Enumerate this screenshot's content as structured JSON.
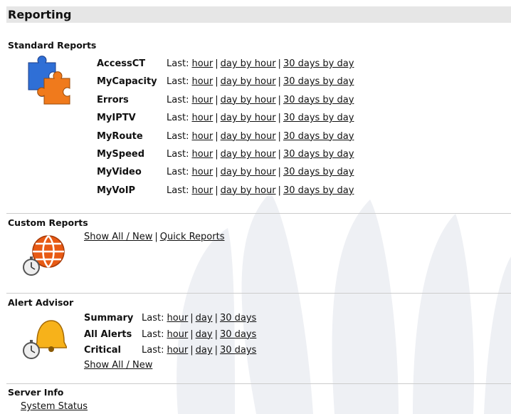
{
  "page": {
    "title": "Reporting"
  },
  "standard_reports": {
    "title": "Standard Reports",
    "last_label": "Last:",
    "links": {
      "hour": "hour",
      "day_by_hour": "day by hour",
      "days30": "30 days by day"
    },
    "items": [
      {
        "name": "AccessCT"
      },
      {
        "name": "MyCapacity"
      },
      {
        "name": "Errors"
      },
      {
        "name": "MyIPTV"
      },
      {
        "name": "MyRoute"
      },
      {
        "name": "MySpeed"
      },
      {
        "name": "MyVideo"
      },
      {
        "name": "MyVoIP"
      }
    ]
  },
  "custom_reports": {
    "title": "Custom Reports",
    "show_all": "Show All / New",
    "quick": "Quick Reports",
    "separator": "|"
  },
  "alert_advisor": {
    "title": "Alert Advisor",
    "last_label": "Last:",
    "links": {
      "hour": "hour",
      "day": "day",
      "days30": "30 days"
    },
    "items": [
      {
        "name": "Summary"
      },
      {
        "name": "All Alerts"
      },
      {
        "name": "Critical"
      }
    ],
    "show_all": "Show All / New"
  },
  "server_info": {
    "title": "Server Info",
    "system_status": "System Status"
  },
  "separator": "|"
}
